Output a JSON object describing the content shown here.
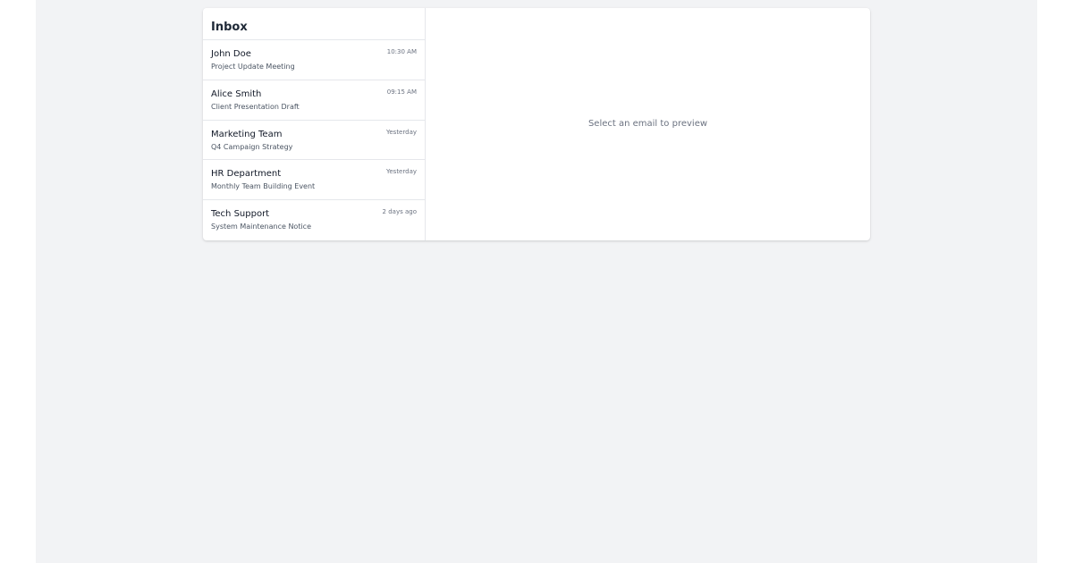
{
  "inbox": {
    "title": "Inbox",
    "emails": [
      {
        "sender": "John Doe",
        "subject": "Project Update Meeting",
        "time": "10:30 AM"
      },
      {
        "sender": "Alice Smith",
        "subject": "Client Presentation Draft",
        "time": "09:15 AM"
      },
      {
        "sender": "Marketing Team",
        "subject": "Q4 Campaign Strategy",
        "time": "Yesterday"
      },
      {
        "sender": "HR Department",
        "subject": "Monthly Team Building Event",
        "time": "Yesterday"
      },
      {
        "sender": "Tech Support",
        "subject": "System Maintenance Notice",
        "time": "2 days ago"
      }
    ]
  },
  "preview": {
    "placeholder": "Select an email to preview"
  },
  "colors": {
    "page_background": "#f2f3f5",
    "panel_background": "#ffffff",
    "divider": "#e5e7eb",
    "text_primary": "#111827",
    "text_secondary": "#4b5563",
    "text_muted": "#6b7280"
  }
}
